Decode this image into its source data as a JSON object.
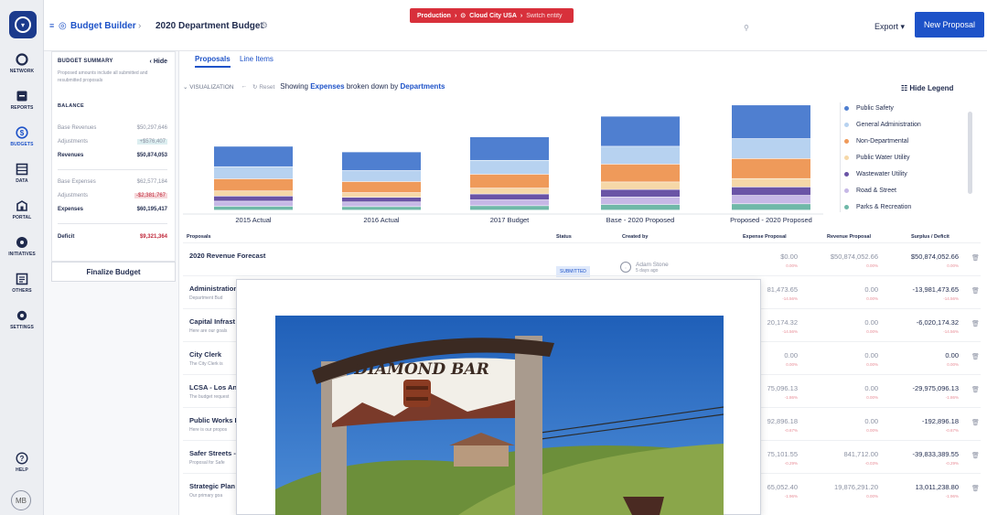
{
  "nav": {
    "items": [
      {
        "label": "NETWORK"
      },
      {
        "label": "REPORTS"
      },
      {
        "label": "BUDGETS"
      },
      {
        "label": "DATA"
      },
      {
        "label": "PORTAL"
      },
      {
        "label": "INITIATIVES"
      },
      {
        "label": "OTHERS"
      },
      {
        "label": "SETTINGS"
      },
      {
        "label": "HELP"
      }
    ],
    "avatar": "MB",
    "accent": "#1d52c8",
    "brand": "#1b3a8c"
  },
  "header": {
    "app": "Budget Builder",
    "separator": "›",
    "title": "2020 Department Budget",
    "env_banner": {
      "env": "Production",
      "entity": "Cloud City USA",
      "switch": "Switch entity"
    },
    "search_placeholder": "",
    "export": "Export ▾",
    "new_proposal": "New Proposal"
  },
  "summary": {
    "title": "BUDGET SUMMARY",
    "hide": "‹ Hide",
    "note": "Proposed amounts include all submitted and resubmitted proposals",
    "balance": "BALANCE",
    "rows": [
      {
        "k": "Base Revenues",
        "v": "$50,297,646"
      },
      {
        "k": "Adjustments",
        "v": "+$576,407"
      },
      {
        "k": "Revenues",
        "v": "$50,874,053"
      },
      {
        "k": "Base Expenses",
        "v": "$62,577,184"
      },
      {
        "k": "Adjustments",
        "v": "-$2,381,767"
      },
      {
        "k": "Expenses",
        "v": "$60,195,417"
      },
      {
        "k": "Deficit",
        "v": "$9,321,364"
      }
    ],
    "finalize": "Finalize Budget"
  },
  "tabs": {
    "proposals": "Proposals",
    "line_items": "Line Items"
  },
  "viz": {
    "label": "VISUALIZATION",
    "reset": "Reset",
    "sentence_pre": "Showing",
    "sentence_measure": "Expenses",
    "sentence_mid": "broken down by",
    "sentence_dim": "Departments",
    "hide_legend": "Hide Legend"
  },
  "chart_data": {
    "type": "bar",
    "stacked": true,
    "categories": [
      "2015 Actual",
      "2016 Actual",
      "2017 Budget",
      "Base - 2020 Proposed",
      "Proposed - 2020 Proposed"
    ],
    "totals": [
      68,
      62,
      78,
      100,
      112
    ],
    "series": [
      {
        "name": "Public Safety",
        "color": "#4f7fd0"
      },
      {
        "name": "General Administration",
        "color": "#b7d2f0"
      },
      {
        "name": "Non-Departmental",
        "color": "#ef9a5a"
      },
      {
        "name": "Public Water Utility",
        "color": "#f6d8a8"
      },
      {
        "name": "Wastewater Utility",
        "color": "#6a54a6"
      },
      {
        "name": "Road & Street",
        "color": "#c6b8e6"
      },
      {
        "name": "Parks & Recreation",
        "color": "#6fb8a8"
      }
    ],
    "segment_shares": [
      0.32,
      0.19,
      0.19,
      0.08,
      0.08,
      0.08,
      0.06
    ],
    "legend_position": "right"
  },
  "table": {
    "headers": {
      "proposals": "Proposals",
      "status": "Status",
      "created": "Created by",
      "expense": "Expense Proposal",
      "revenue": "Revenue Proposal",
      "surplus": "Surplus / Deficit"
    },
    "rows": [
      {
        "name": "2020 Revenue Forecast",
        "sub": "",
        "status": "SUBMITTED",
        "creator": "Adam Stone",
        "created_ago": "5 days ago",
        "expense": "$0.00",
        "expense_pct": "0.00%",
        "revenue": "$50,874,052.66",
        "revenue_pct": "0.00%",
        "surplus": "$50,874,052.66",
        "surplus_pct": "0.00%"
      },
      {
        "name": "Administration",
        "sub": "Department Bud",
        "expense": "81,473.65",
        "expense_pct": "-14.56%",
        "revenue": "0.00",
        "revenue_pct": "0.00%",
        "surplus": "-13,981,473.65",
        "surplus_pct": "-14.56%"
      },
      {
        "name": "Capital Infrast",
        "sub": "Here are our goals",
        "expense": "20,174.32",
        "expense_pct": "-14.56%",
        "revenue": "0.00",
        "revenue_pct": "0.00%",
        "surplus": "-6,020,174.32",
        "surplus_pct": "-14.56%"
      },
      {
        "name": "City Clerk",
        "sub": "The City Clerk is",
        "expense": "0.00",
        "expense_pct": "0.00%",
        "revenue": "0.00",
        "revenue_pct": "0.00%",
        "surplus": "0.00",
        "surplus_pct": "0.00%"
      },
      {
        "name": "LCSA - Los An",
        "sub": "The budget request",
        "expense": "75,096.13",
        "expense_pct": "-1.86%",
        "revenue": "0.00",
        "revenue_pct": "0.00%",
        "surplus": "-29,975,096.13",
        "surplus_pct": "-1.86%"
      },
      {
        "name": "Public Works I",
        "sub": "Here is our propos",
        "expense": "92,896.18",
        "expense_pct": "-0.67%",
        "revenue": "0.00",
        "revenue_pct": "0.00%",
        "surplus": "-192,896.18",
        "surplus_pct": "-0.67%"
      },
      {
        "name": "Safer Streets -",
        "sub": "Proposal for Safe",
        "expense": "75,101.55",
        "expense_pct": "-0.29%",
        "revenue": "841,712.00",
        "revenue_pct": "-0.03%",
        "surplus": "-39,833,389.55",
        "surplus_pct": "-0.29%"
      },
      {
        "name": "Strategic Plan",
        "sub": "Our primary goa",
        "expense": "65,052.40",
        "expense_pct": "-1.96%",
        "revenue": "19,876,291.20",
        "revenue_pct": "0.00%",
        "surplus": "13,011,238.80",
        "surplus_pct": "-1.96%"
      }
    ]
  },
  "overlay": {
    "sign_text": "DIAMOND BAR"
  }
}
